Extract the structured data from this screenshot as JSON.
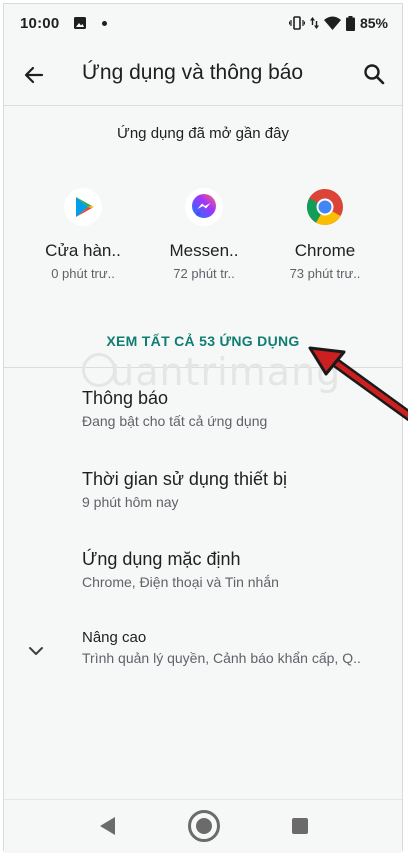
{
  "status_bar": {
    "time": "10:00",
    "battery_percent": "85%",
    "icons": [
      "image-icon",
      "notification-dot-icon",
      "vibrate-icon",
      "data-arrows-icon",
      "wifi-icon",
      "battery-icon"
    ]
  },
  "app_bar": {
    "title": "Ứng dụng và thông báo",
    "back_icon": "arrow-left-icon",
    "search_icon": "search-icon"
  },
  "recent": {
    "header": "Ứng dụng đã mở gần đây",
    "apps": [
      {
        "name": "Cửa hàn..",
        "subtitle": "0 phút trư..",
        "icon": "play-store-icon"
      },
      {
        "name": "Messen..",
        "subtitle": "72 phút tr..",
        "icon": "messenger-icon"
      },
      {
        "name": "Chrome",
        "subtitle": "73 phút trư..",
        "icon": "chrome-icon"
      }
    ],
    "see_all": "XEM TẤT CẢ 53 ỨNG DỤNG"
  },
  "watermark": "uantrimang",
  "settings": [
    {
      "title": "Thông báo",
      "subtitle": "Đang bật cho tất cả ứng dụng"
    },
    {
      "title": "Thời gian sử dụng thiết bị",
      "subtitle": "9 phút hôm nay"
    },
    {
      "title": "Ứng dụng mặc định",
      "subtitle": "Chrome, Điện thoại và Tin nhắn"
    },
    {
      "title": "Nâng cao",
      "subtitle": "Trình quản lý quyền, Cảnh báo khẩn cấp, Q.."
    }
  ],
  "colors": {
    "accent": "#0f7d72",
    "background": "#f6f7f7",
    "annotation_arrow": "#cc1f1f"
  },
  "nav_bar": {
    "icons": [
      "nav-back-icon",
      "nav-home-icon",
      "nav-recents-icon"
    ]
  }
}
